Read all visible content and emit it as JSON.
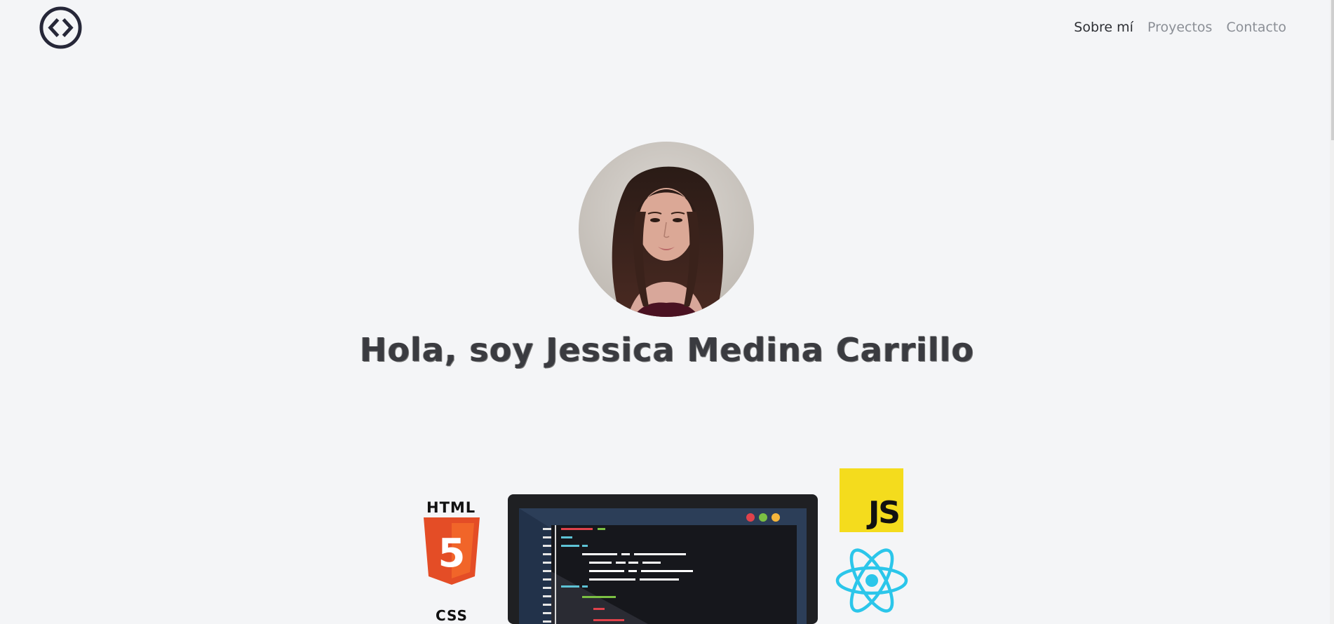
{
  "nav": {
    "items": [
      {
        "label": "Sobre mí",
        "active": true
      },
      {
        "label": "Proyectos",
        "active": false
      },
      {
        "label": "Contacto",
        "active": false
      }
    ]
  },
  "hero": {
    "headline": "Hola, soy Jessica Medina Carrillo"
  },
  "tech": {
    "html_label": "HTML",
    "html_number": "5",
    "css_label": "CSS",
    "js_label": "JS"
  },
  "colors": {
    "background": "#f4f5f7",
    "nav_active": "#2d2f34",
    "nav_inactive": "#8b8f96",
    "html_orange": "#e44d26",
    "js_yellow": "#f4dc1d",
    "react_cyan": "#2bc6ea"
  },
  "icons": {
    "logo": "code-brackets-circle-icon"
  }
}
